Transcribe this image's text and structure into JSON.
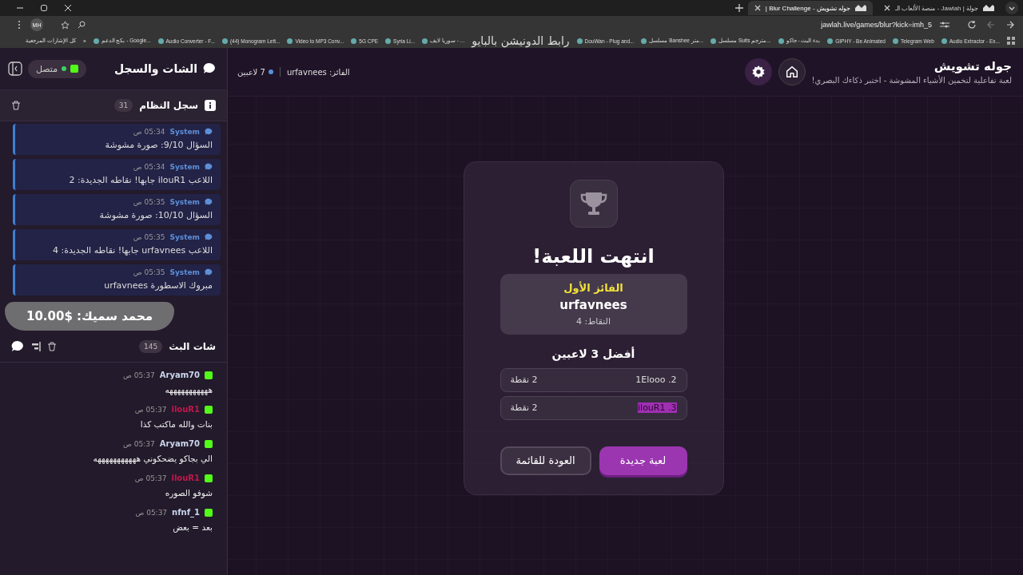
{
  "browser": {
    "tabs": [
      {
        "title": "جولة | Jawlah - منصة الألعاب الـ",
        "selected": false
      },
      {
        "title": "جوله تشويش - Blur Challenge |",
        "selected": true
      }
    ],
    "address": "jawlah.live/games/blur?kick=imh_5",
    "profile": "MH",
    "bookmarks": [
      "Audio Extractor - Ex...",
      "Telegram Web",
      "GIPHY - Be Animated",
      "بدء البث - جاكو",
      "مسلسل Suits مترجم...",
      "مسلسل Banshee متر...",
      "DouWan - Plug and...",
      "سوريا لايف - ...",
      "Syria Li...",
      "5G CPE",
      "Video to MP3 Conv...",
      "(44) Monogram Lett...",
      "Audio Converter - F...",
      "بكج الدعم - Google..."
    ],
    "more": "»",
    "all_bookmarks": "كل الإشارات المرجعية"
  },
  "overlay": {
    "caption": "رابط الدونيشن بالبايو",
    "donation": "محمد سميك: $10.00"
  },
  "sidebar": {
    "title": "الشات والسجل",
    "status": "متصل",
    "system_log": {
      "title": "سجل النظام",
      "count": "31",
      "entries": [
        {
          "author": "System",
          "time": "05:34 ص",
          "text": "السؤال 9/10: صورة مشوشة"
        },
        {
          "author": "System",
          "time": "05:34 ص",
          "text": "اللاعب ilouR1 جابها! نقاطه الجديدة: 2"
        },
        {
          "author": "System",
          "time": "05:35 ص",
          "text": "السؤال 10/10: صورة مشوشة"
        },
        {
          "author": "System",
          "time": "05:35 ص",
          "text": "اللاعب urfavnees جابها! نقاطه الجديدة: 4"
        },
        {
          "author": "System",
          "time": "05:35 ص",
          "text": "مبروك الاسطورة urfavnees"
        }
      ]
    },
    "stream_chat": {
      "title": "شات البث",
      "count": "145",
      "messages": [
        {
          "user": "Aryam70",
          "color": "#c9d6ec",
          "time": "05:37 ص",
          "text": "هههههههههههه"
        },
        {
          "user": "ilouR1",
          "color": "#c2184b",
          "time": "05:37 ص",
          "text": "بنات والله ماكتب كذا"
        },
        {
          "user": "Aryam70",
          "color": "#c9d6ec",
          "time": "05:37 ص",
          "text": "الي بجاكو يضحكوني هههههههههههه"
        },
        {
          "user": "ilouR1",
          "color": "#c2184b",
          "time": "05:37 ص",
          "text": "شوفو الصوره"
        },
        {
          "user": "nfnf_1",
          "color": "#c9d6ec",
          "time": "05:37 ص",
          "text": "بعد = بعض"
        }
      ]
    }
  },
  "header": {
    "title": "جوله تشويش",
    "subtitle": "لعبة تفاعلية لتخمين الأشياء المشوشة - اختبر ذكاءك البصري!",
    "players": "7 لاعبين",
    "winner": "الفائز: urfavnees"
  },
  "result": {
    "title": "انتهت اللعبة!",
    "winner_label": "الفائز الأول",
    "winner_name": "urfavnees",
    "winner_points": "النقاط: 4",
    "top_title": "أفضل 3 لاعبين",
    "ranking": [
      {
        "name": "2. 1Elooo",
        "points": "2 نقطة",
        "highlighted": false
      },
      {
        "name": "3. ilouR1",
        "points": "2 نقطة",
        "highlighted": true
      }
    ],
    "buttons": [
      {
        "label": "لعبة جديدة",
        "kind": "primary"
      },
      {
        "label": "العودة للقائمة",
        "kind": "secondary"
      }
    ]
  }
}
